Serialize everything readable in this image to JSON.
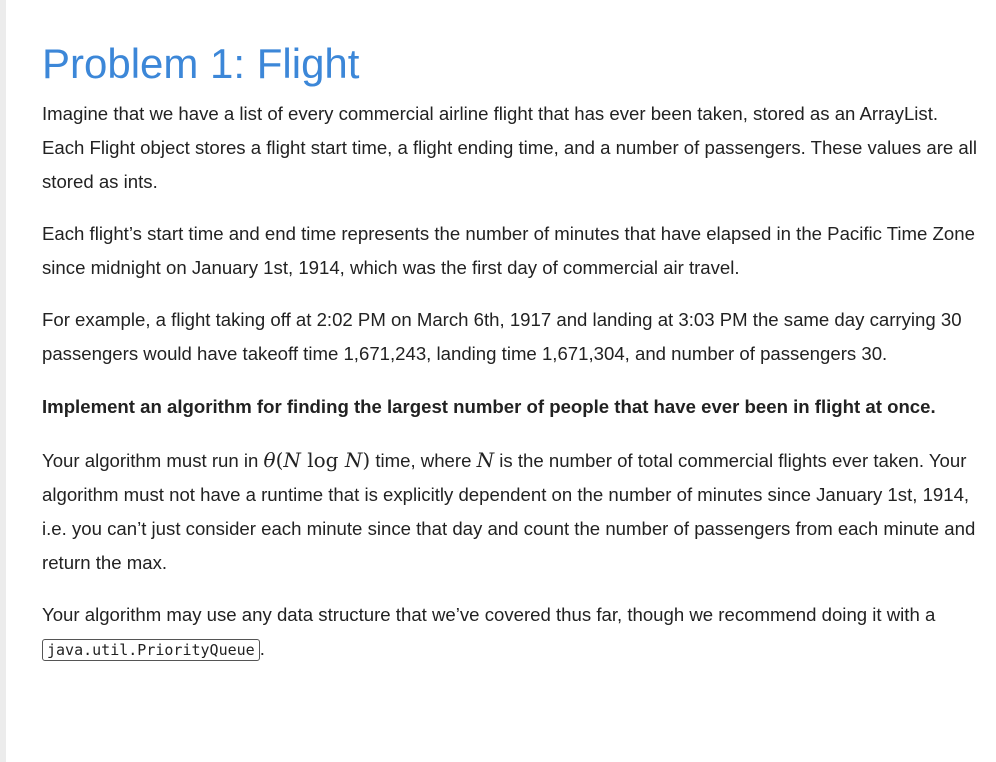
{
  "title": "Problem 1: Flight",
  "paragraphs": {
    "p1": "Imagine that we have a list of every commercial airline flight that has ever been taken, stored as an ArrayList. Each Flight object stores a flight start time, a flight ending time, and a number of passengers. These values are all stored as ints.",
    "p2": "Each flight’s start time and end time represents the number of minutes that have elapsed in the Pacific Time Zone since midnight on January 1st, 1914, which was the first day of commercial air travel.",
    "p3": "For example, a flight taking off at 2:02 PM on March 6th, 1917 and landing at 3:03 PM the same day carrying 30 passengers would have takeoff time 1,671,243, landing time 1,671,304, and number of passengers 30.",
    "p4": "Implement an algorithm for finding the largest number of people that have ever been in flight at once.",
    "p5_before": "Your algorithm must run in ",
    "p5_math_theta": "θ",
    "p5_math_open": "(",
    "p5_math_n1": "N",
    "p5_math_log": " log ",
    "p5_math_n2": "N",
    "p5_math_close": ")",
    "p5_mid": " time, where ",
    "p5_math_n3": "N",
    "p5_after": " is the number of total commercial flights ever taken. Your algorithm must not have a runtime that is explicitly dependent on the number of minutes since January 1st, 1914, i.e. you can’t just consider each minute since that day and count the number of passengers from each minute and return the max.",
    "p6_before": "Your algorithm may use any data structure that we’ve covered thus far, though we recommend doing it with a ",
    "p6_code": "java.util.PriorityQueue",
    "p6_after": "."
  }
}
